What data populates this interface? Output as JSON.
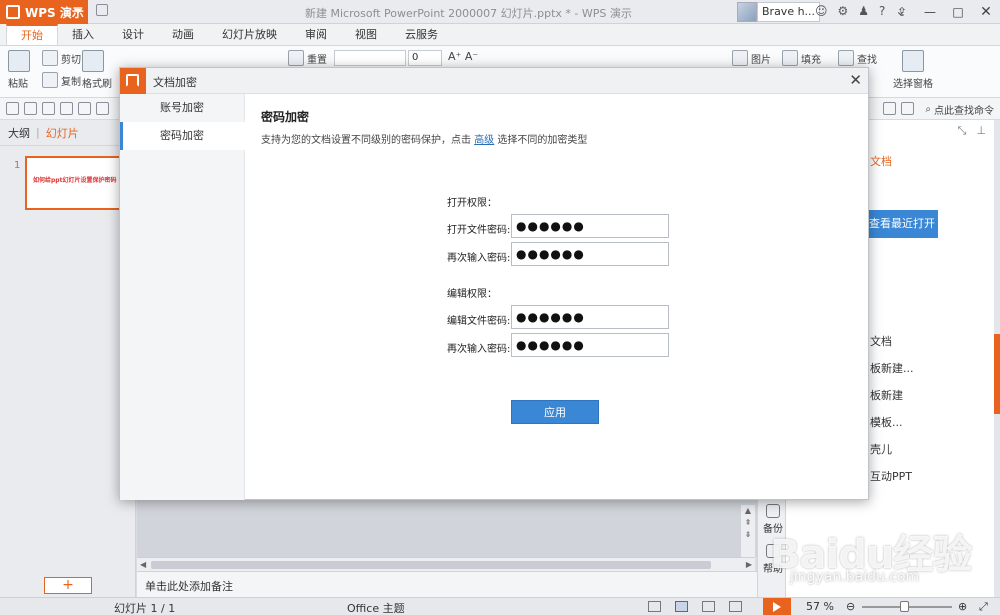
{
  "titlebar": {
    "app_name": "WPS 演示",
    "doc_title": "新建 Microsoft PowerPoint 2000007 幻灯片.pptx * - WPS 演示",
    "user_name": "Brave h..."
  },
  "menu": {
    "tabs": [
      "开始",
      "插入",
      "设计",
      "动画",
      "幻灯片放映",
      "审阅",
      "视图",
      "云服务"
    ],
    "active": "开始"
  },
  "ribbon": {
    "paste": "粘贴",
    "cut": "剪切",
    "copy": "复制",
    "format_painter": "格式刷",
    "reset": "重置",
    "font_size": "0",
    "picture": "图片",
    "fill": "填充",
    "find": "查找",
    "select_pane": "选择窗格"
  },
  "toolbar2": {
    "find_command": "点此查找命令"
  },
  "left_panel": {
    "tab_outline": "大纲",
    "tab_slides": "幻灯片",
    "slide_number": "1",
    "slide_thumb_text": "如何给ppt幻灯片设置保护密码",
    "add_symbol": "+"
  },
  "notes": {
    "placeholder": "单击此处添加备注"
  },
  "side_strip": {
    "backup": "备份",
    "help": "帮助"
  },
  "task_pane": {
    "doc_label": "文档",
    "recent_button": "查看最近打开",
    "links": [
      "文档",
      "板新建...",
      "板新建",
      "模板...",
      "壳儿",
      "互动PPT"
    ]
  },
  "statusbar": {
    "slide_count": "幻灯片 1 / 1",
    "theme": "Office 主题",
    "zoom": "57 %",
    "zoom_level": 0.57
  },
  "watermark": {
    "brand": "Baidu经验",
    "url": "jingyan.baidu.com"
  },
  "dialog": {
    "title": "文档加密",
    "nav": [
      "账号加密",
      "密码加密"
    ],
    "active_nav": "密码加密",
    "section_title": "密码加密",
    "description_pre": "支持为您的文档设置不同级别的密码保护，点击",
    "description_link": "高级",
    "description_post": "选择不同的加密类型",
    "open_perm": {
      "heading": "打开权限：",
      "password_label": "打开文件密码:",
      "confirm_label": "再次输入密码:",
      "password_value": "●●●●●●",
      "confirm_value": "●●●●●●"
    },
    "edit_perm": {
      "heading": "编辑权限：",
      "password_label": "编辑文件密码:",
      "confirm_label": "再次输入密码:",
      "password_value": "●●●●●●",
      "confirm_value": "●●●●●●"
    },
    "apply_label": "应用"
  },
  "colors": {
    "accent": "#e8641e",
    "primary_button": "#3a87d6"
  }
}
